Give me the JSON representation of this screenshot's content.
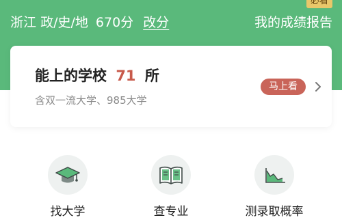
{
  "header": {
    "province": "浙江",
    "subjects": "政/史/地",
    "score": "670分",
    "edit_label": "改分",
    "report_label": "我的成绩报告",
    "badge": "必看"
  },
  "card": {
    "title_prefix": "能上的学校",
    "count": "71",
    "title_suffix": "所",
    "subtitle": "含双一流大学、985大学",
    "button_label": "马上看"
  },
  "tools": [
    {
      "label": "找大学",
      "icon": "graduation-cap-icon"
    },
    {
      "label": "查专业",
      "icon": "open-book-icon"
    },
    {
      "label": "测录取概率",
      "icon": "area-chart-icon"
    }
  ],
  "colors": {
    "brand_green": "#5ab97b",
    "accent_red": "#c85a4b",
    "button_red": "#c96459",
    "badge_gold": "#e9c76a"
  }
}
